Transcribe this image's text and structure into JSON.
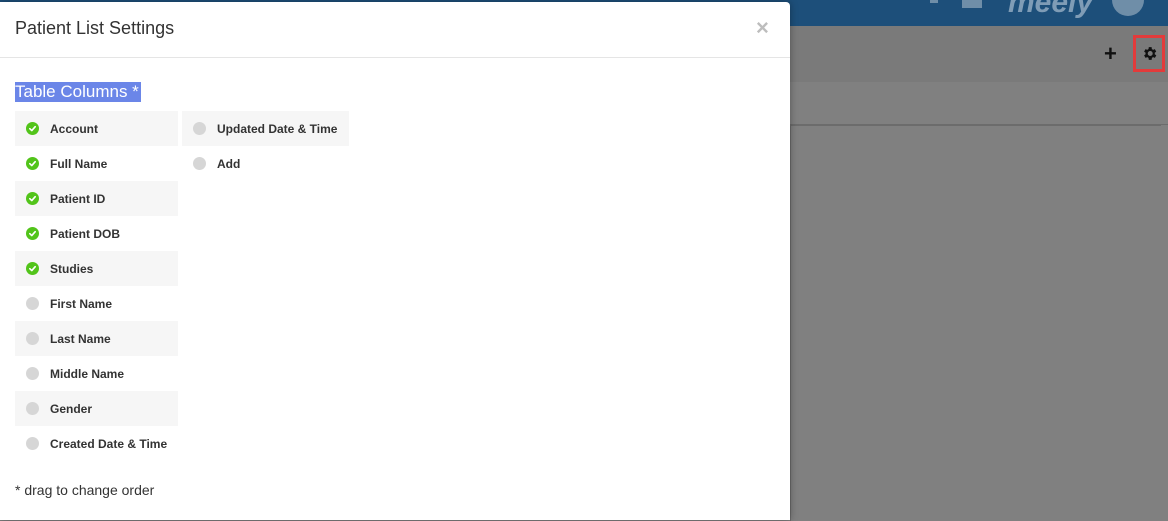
{
  "modal": {
    "title": "Patient List Settings",
    "close_label": "×",
    "section_title": "Table Columns *",
    "footnote": "* drag to change order",
    "columns_left": [
      {
        "label": "Account",
        "checked": true
      },
      {
        "label": "Full Name",
        "checked": true
      },
      {
        "label": "Patient ID",
        "checked": true
      },
      {
        "label": "Patient DOB",
        "checked": true
      },
      {
        "label": "Studies",
        "checked": true
      },
      {
        "label": "First Name",
        "checked": false
      },
      {
        "label": "Last Name",
        "checked": false
      },
      {
        "label": "Middle Name",
        "checked": false
      },
      {
        "label": "Gender",
        "checked": false
      },
      {
        "label": "Created Date & Time",
        "checked": false
      }
    ],
    "columns_right": [
      {
        "label": "Updated Date & Time",
        "checked": false
      },
      {
        "label": "Add",
        "checked": false
      }
    ]
  },
  "background": {
    "toolbar": {
      "add_icon": "plus-icon",
      "settings_icon": "gear-icon",
      "add_label": "+"
    }
  },
  "colors": {
    "checked": "#52c41a",
    "unchecked": "#d6d6d6",
    "highlight": "#6b86e8",
    "header": "#1d4f7a",
    "gear_outline": "#e33b3b"
  }
}
